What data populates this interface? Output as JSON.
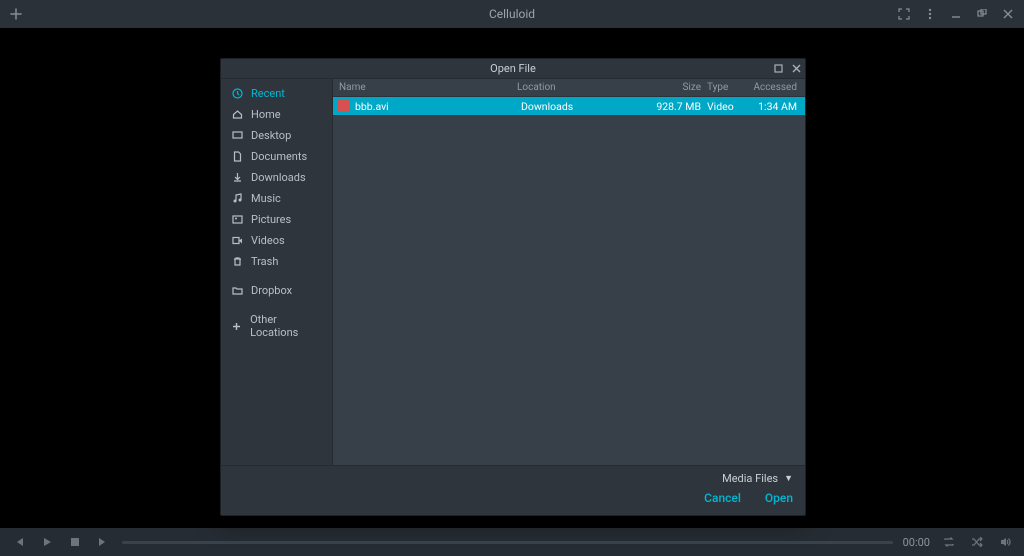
{
  "app": {
    "title": "Celluloid"
  },
  "player": {
    "time": "00:00"
  },
  "dialog": {
    "title": "Open File",
    "columns": {
      "name": "Name",
      "location": "Location",
      "size": "Size",
      "type": "Type",
      "accessed": "Accessed"
    },
    "filter": "Media Files",
    "cancel": "Cancel",
    "open": "Open",
    "sidebar": {
      "recent": "Recent",
      "home": "Home",
      "desktop": "Desktop",
      "documents": "Documents",
      "downloads": "Downloads",
      "music": "Music",
      "pictures": "Pictures",
      "videos": "Videos",
      "trash": "Trash",
      "dropbox": "Dropbox",
      "other": "Other Locations"
    },
    "files": [
      {
        "name": "bbb.avi",
        "location": "Downloads",
        "size": "928.7 MB",
        "type": "Video",
        "accessed": "1:34 AM"
      }
    ]
  }
}
